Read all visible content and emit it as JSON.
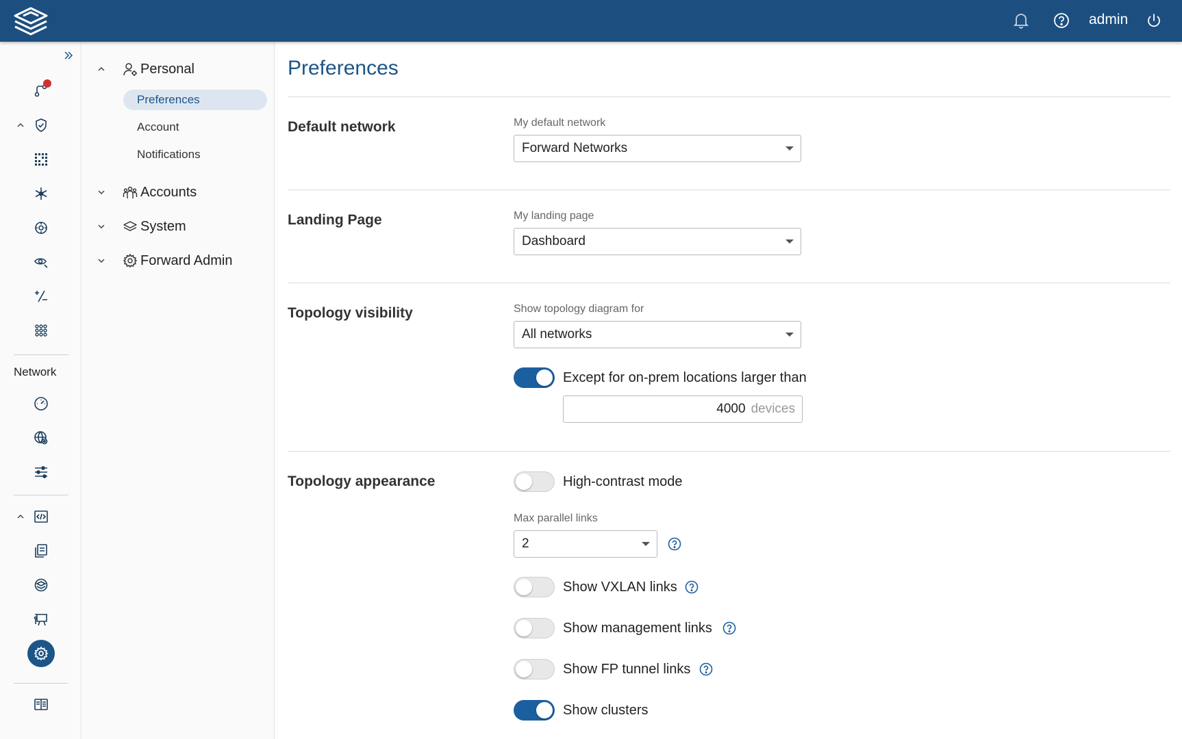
{
  "header": {
    "user": "admin",
    "icons": [
      "app-logo-icon",
      "bell-icon",
      "help-circle-icon",
      "power-icon"
    ]
  },
  "rail": {
    "section_label": "Network",
    "icons": [
      "expand-double-chevron-icon",
      "path-trace-icon",
      "shield-check-icon",
      "grid-dots-icon",
      "snowflake-icon",
      "gear-star-icon",
      "eye-search-icon",
      "plus-minus-icon",
      "apps-grid-icon",
      "gauge-icon",
      "globe-gear-icon",
      "sliders-icon",
      "code-window-icon",
      "document-stack-icon",
      "layers-circle-icon",
      "presentation-icon",
      "settings-gear-icon",
      "book-icon"
    ]
  },
  "nav": {
    "personal": {
      "label": "Personal",
      "items": [
        "Preferences",
        "Account",
        "Notifications"
      ]
    },
    "accounts": "Accounts",
    "system": "System",
    "forward_admin": "Forward Admin"
  },
  "main": {
    "title": "Preferences",
    "default_network": {
      "section": "Default network",
      "label": "My default network",
      "value": "Forward Networks"
    },
    "landing_page": {
      "section": "Landing Page",
      "label": "My landing page",
      "value": "Dashboard"
    },
    "topology_visibility": {
      "section": "Topology visibility",
      "label": "Show topology diagram for",
      "value": "All networks",
      "except_toggle_label": "Except for on-prem locations larger than",
      "except_toggle_on": true,
      "device_count": "4000",
      "device_unit": "devices"
    },
    "topology_appearance": {
      "section": "Topology appearance",
      "high_contrast_label": "High-contrast mode",
      "high_contrast_on": false,
      "max_links_label": "Max parallel links",
      "max_links_value": "2",
      "vxlan_label": "Show VXLAN links",
      "vxlan_on": false,
      "mgmt_label": "Show management links",
      "mgmt_on": false,
      "fp_tunnel_label": "Show FP tunnel links",
      "fp_tunnel_on": false,
      "clusters_label": "Show clusters",
      "clusters_on": true
    }
  },
  "colors": {
    "header": "#1c4f80",
    "accent": "#1c5588",
    "toggle_on": "#1c5fa0",
    "active_nav_bg": "#dde6f0",
    "badge": "#d32f2f"
  }
}
